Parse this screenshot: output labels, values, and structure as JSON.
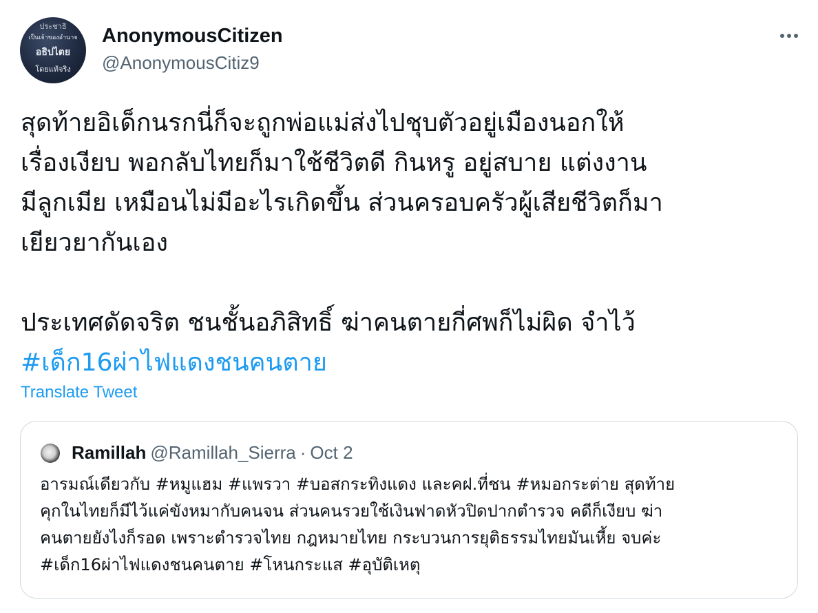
{
  "author": {
    "name": "AnonymousCitizen",
    "handle": "@AnonymousCitiz9",
    "avatar_text": [
      "ประชาธิ",
      "เป็นเจ้าของอำนาจ",
      "อธิปไตย",
      "โดยแท้จริง"
    ]
  },
  "tweet": {
    "paragraph1": [
      "สุดท้ายอิเด็กนรกนี่ก็จะถูกพ่อแม่ส่งไปชุบตัวอยู่เมืองนอกให้",
      "เรื่องเงียบ พอกลับไทยก็มาใช้ชีวิตดี กินหรู อยู่สบาย แต่งงาน",
      "มีลูกเมีย เหมือนไม่มีอะไรเกิดขึ้น ส่วนครอบครัวผู้เสียชีวิตก็มา",
      "เยียวยากันเอง"
    ],
    "paragraph2": "ประเทศดัดจริต ชนชั้นอภิสิทธิ์ ฆ่าคนตายกี่ศพก็ไม่ผิด จำไว้",
    "hashtag": "#เด็ก16ผ่าไฟแดงชนคนตาย"
  },
  "translate_label": "Translate Tweet",
  "quote": {
    "name": "Ramillah",
    "handle": "@Ramillah_Sierra",
    "separator": "·",
    "date": "Oct 2",
    "lines": [
      "อารมณ์เดียวกับ #หมูแฮม #แพรวา #บอสกระทิงแดง และคฝ.ที่ชน #หมอกระต่าย สุดท้าย",
      "คุกในไทยก็มีไว้แค่ขังหมากับคนจน ส่วนคนรวยใช้เงินฟาดหัวปิดปากตำรวจ คดีก็เงียบ ฆ่า",
      "คนตายยังไงก็รอด เพราะตำรวจไทย กฎหมายไทย กระบวนการยุติธรรมไทยมันเหี้ย จบค่ะ",
      "#เด็ก16ผ่าไฟแดงชนคนตาย #โหนกระแส #อุบัติเหตุ"
    ]
  },
  "colors": {
    "link": "#1d9bf0",
    "secondary_text": "#536471",
    "primary_text": "#0f1419",
    "border": "#cfd9de"
  },
  "icons": {
    "more": "more-horizontal-icon"
  }
}
